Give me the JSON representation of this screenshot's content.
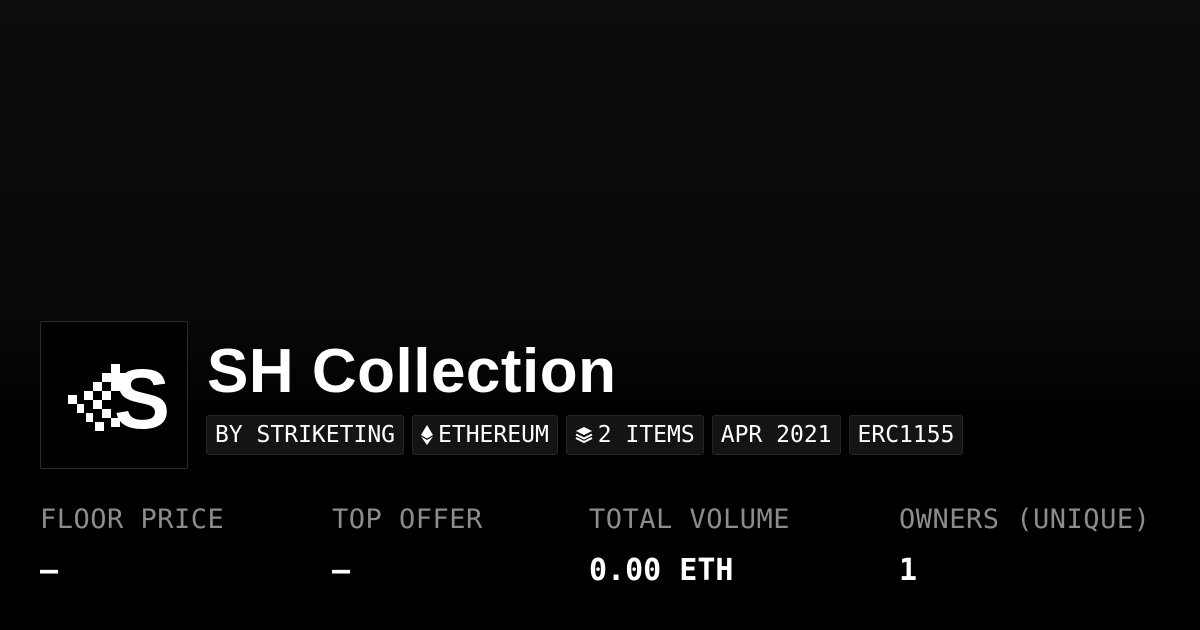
{
  "collection": {
    "title": "SH Collection",
    "logo_text": "S",
    "tags": [
      {
        "label": "BY STRIKETING",
        "icon": null
      },
      {
        "label": "ETHEREUM",
        "icon": "ethereum-icon"
      },
      {
        "label": "2 ITEMS",
        "icon": "layers-icon"
      },
      {
        "label": "APR 2021",
        "icon": null
      },
      {
        "label": "ERC1155",
        "icon": null
      }
    ]
  },
  "stats": [
    {
      "label": "FLOOR PRICE",
      "value": "–"
    },
    {
      "label": "TOP OFFER",
      "value": "–"
    },
    {
      "label": "TOTAL VOLUME",
      "value": "0.00 ETH"
    },
    {
      "label": "OWNERS (UNIQUE)",
      "value": "1"
    }
  ],
  "colors": {
    "background": "#000000",
    "banner": "#0d0d0d",
    "label": "#8c8c8c",
    "tag_bg": "#141414",
    "tag_border": "#262626"
  }
}
